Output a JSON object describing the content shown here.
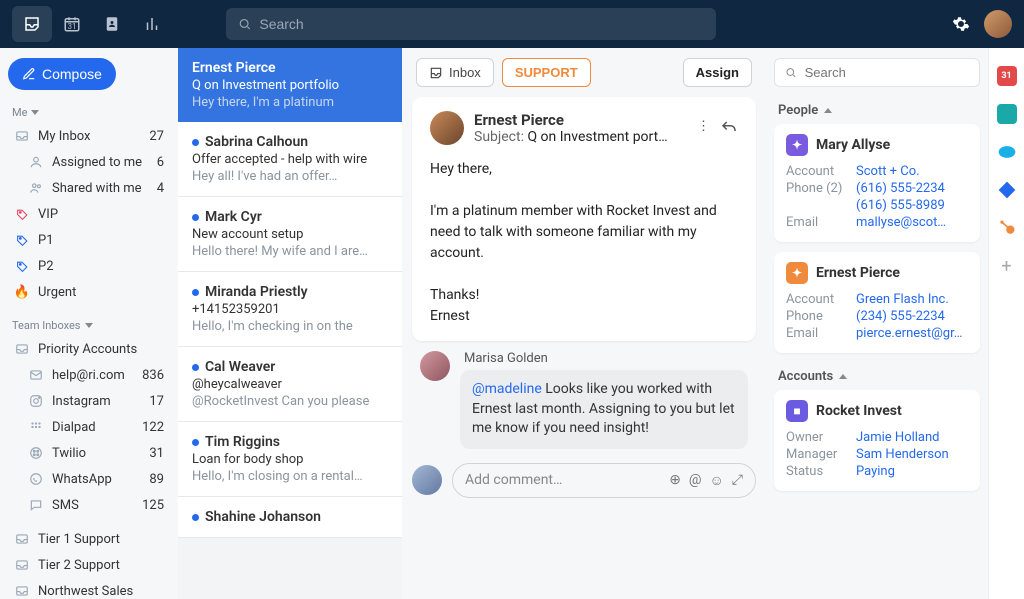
{
  "topbar": {
    "search_placeholder": "Search"
  },
  "sidebar": {
    "compose": "Compose",
    "me_header": "Me",
    "team_header": "Team Inboxes",
    "me_items": [
      {
        "icon": "inbox",
        "label": "My Inbox",
        "count": "27"
      },
      {
        "icon": "user",
        "label": "Assigned to me",
        "count": "6",
        "indent": true
      },
      {
        "icon": "users",
        "label": "Shared with me",
        "count": "4",
        "indent": true
      },
      {
        "icon": "tag",
        "label": "VIP",
        "count": "",
        "color": "#e24a68"
      },
      {
        "icon": "tag",
        "label": "P1",
        "count": "",
        "color": "#2469ed"
      },
      {
        "icon": "tag",
        "label": "P2",
        "count": "",
        "color": "#2469ed"
      },
      {
        "icon": "fire",
        "label": "Urgent",
        "count": ""
      }
    ],
    "team_items": [
      {
        "icon": "inbox",
        "label": "Priority Accounts",
        "count": ""
      },
      {
        "icon": "mail",
        "label": "help@ri.com",
        "count": "836",
        "indent": true
      },
      {
        "icon": "instagram",
        "label": "Instagram",
        "count": "17",
        "indent": true
      },
      {
        "icon": "dialpad",
        "label": "Dialpad",
        "count": "122",
        "indent": true
      },
      {
        "icon": "twilio",
        "label": "Twilio",
        "count": "31",
        "indent": true
      },
      {
        "icon": "whatsapp",
        "label": "WhatsApp",
        "count": "89",
        "indent": true
      },
      {
        "icon": "sms",
        "label": "SMS",
        "count": "125",
        "indent": true
      }
    ],
    "extra": [
      {
        "label": "Tier 1 Support"
      },
      {
        "label": "Tier 2 Support"
      },
      {
        "label": "Northwest Sales"
      }
    ]
  },
  "conversations": [
    {
      "name": "Ernest Pierce",
      "subject": "Q on Investment portfolio",
      "preview": "Hey there, I'm a platinum",
      "dot": false,
      "selected": true
    },
    {
      "name": "Sabrina Calhoun",
      "subject": "Offer accepted - help with wire",
      "preview": "Hey all! I've had an offer…",
      "dot": true
    },
    {
      "name": "Mark Cyr",
      "subject": "New account setup",
      "preview": "Hello there! My wife and I are…",
      "dot": true
    },
    {
      "name": "Miranda Priestly",
      "subject": "+14152359201",
      "preview": "Hello, I'm checking in on the",
      "dot": true
    },
    {
      "name": "Cal Weaver",
      "subject": "@heycalweaver",
      "preview": "@RocketInvest Can you please",
      "dot": true
    },
    {
      "name": "Tim Riggins",
      "subject": "Loan for body shop",
      "preview": "Hello, I'm closing on a rental…",
      "dot": true
    },
    {
      "name": "Shahine Johanson",
      "subject": "",
      "preview": "",
      "dot": true
    }
  ],
  "main": {
    "inbox_btn": "Inbox",
    "support_btn": "SUPPORT",
    "assign_btn": "Assign",
    "from": "Ernest Pierce",
    "subject_label": "Subject:",
    "subject": "Q on Investment port…",
    "body": "Hey there,\n\nI'm a platinum member with Rocket Invest and need to talk with someone familiar with my account.\n\nThanks!\nErnest",
    "comment_author": "Marisa Golden",
    "comment_mention": "@madeline",
    "comment_text": " Looks like you worked with Ernest last month. Assigning to you but let me know if you need insight!",
    "composer_placeholder": "Add comment…"
  },
  "right": {
    "search_placeholder": "Search",
    "people_header": "People",
    "accounts_header": "Accounts",
    "people": [
      {
        "name": "Mary Allyse",
        "badge_color": "#7a5be0",
        "rows": [
          {
            "k": "Account",
            "v": "Scott + Co."
          },
          {
            "k": "Phone (2)",
            "v": "(616) 555-2234"
          },
          {
            "k": "",
            "v": "(616) 555-8989"
          },
          {
            "k": "Email",
            "v": "mallyse@scot…"
          }
        ]
      },
      {
        "name": "Ernest Pierce",
        "badge_color": "#f08a3c",
        "rows": [
          {
            "k": "Account",
            "v": "Green Flash Inc."
          },
          {
            "k": "Phone",
            "v": "(234) 555-2234"
          },
          {
            "k": "Email",
            "v": "pierce.ernest@gr…"
          }
        ]
      }
    ],
    "accounts": [
      {
        "name": "Rocket Invest",
        "badge_color": "#6a5be0",
        "rows": [
          {
            "k": "Owner",
            "v": "Jamie Holland"
          },
          {
            "k": "Manager",
            "v": "Sam Henderson"
          },
          {
            "k": "Status",
            "v": "Paying"
          }
        ]
      }
    ]
  }
}
